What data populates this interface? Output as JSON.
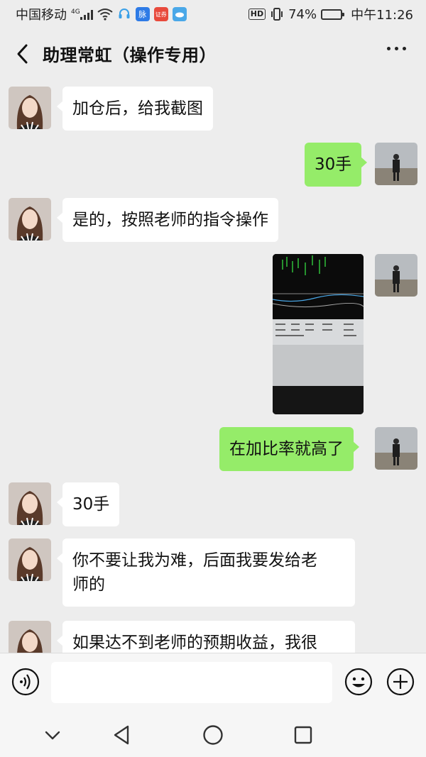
{
  "status_bar": {
    "carrier": "中国移动",
    "network": "4G",
    "hd": "HD",
    "battery": "74%",
    "battery_level": 0.74,
    "time": "中午11:26",
    "app_icon_labels": [
      "脉",
      "证券",
      ""
    ]
  },
  "header": {
    "title": "助理常虹（操作专用）"
  },
  "messages": [
    {
      "side": "in",
      "text": "加仓后，给我截图"
    },
    {
      "side": "out",
      "text": "30手"
    },
    {
      "side": "in",
      "text": "是的，按照老师的指令操作"
    },
    {
      "side": "out",
      "type": "image",
      "description_icon": "trading-screenshot-image"
    },
    {
      "side": "out",
      "text": "在加比率就高了"
    },
    {
      "side": "in",
      "text": "30手"
    },
    {
      "side": "in",
      "text_line1": "你不要让我为难，后面我要发给老",
      "text_line2": "师的"
    },
    {
      "side": "in",
      "text": "如果达不到老师的预期收益，我很"
    }
  ],
  "input_bar": {
    "placeholder": "",
    "icons": [
      "voice-icon",
      "emoji-icon",
      "plus-icon"
    ]
  },
  "nav_bar": {
    "icons": [
      "chevron-down-icon",
      "back-triangle-icon",
      "home-circle-icon",
      "recents-square-icon"
    ]
  },
  "colors": {
    "background": "#ededed",
    "incoming_bubble": "#ffffff",
    "outgoing_bubble": "#95ec69"
  }
}
